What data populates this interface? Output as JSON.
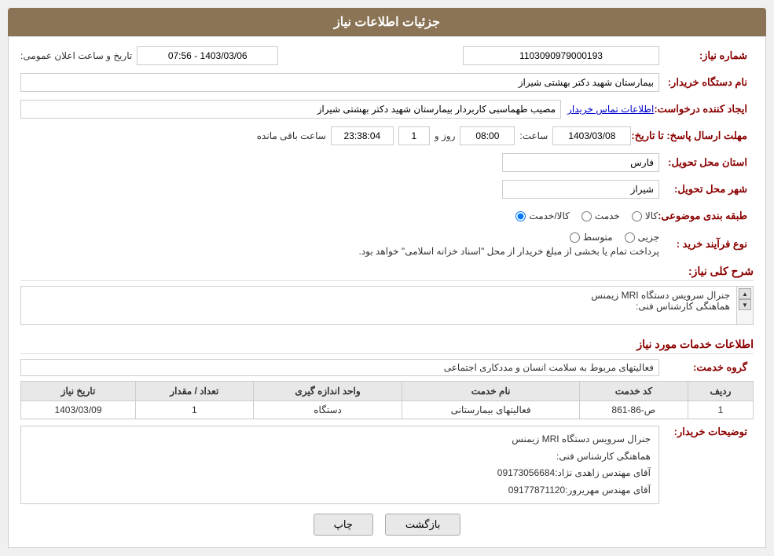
{
  "header": {
    "title": "جزئیات اطلاعات نیاز"
  },
  "fields": {
    "shomareNiaz_label": "شماره نیاز:",
    "shomareNiaz_value": "1103090979000193",
    "namDastgah_label": "نام دستگاه خریدار:",
    "namDastgah_value": "بیمارستان شهید دکتر بهشتی شیراز",
    "ijadKonande_label": "ایجاد کننده درخواست:",
    "ijadKonande_value": "مصیب طهماسبی کاربردار بیمارستان شهید دکتر بهشتی شیراز",
    "ijadKonande_link": "اطلاعات تماس خریدار",
    "mohlat_label": "مهلت ارسال پاسخ: تا تاریخ:",
    "mohlat_date": "1403/03/08",
    "mohlat_saat_label": "ساعت:",
    "mohlat_saat": "08:00",
    "mohlat_roz_label": "روز و",
    "mohlat_roz": "1",
    "mohlat_baqi_label": "ساعت باقی مانده",
    "mohlat_baqi": "23:38:04",
    "ostan_label": "استان محل تحویل:",
    "ostan_value": "فارس",
    "shahr_label": "شهر محل تحویل:",
    "shahr_value": "شیراز",
    "tabaqe_label": "طبقه بندی موضوعی:",
    "tabaqe_radio1": "کالا",
    "tabaqe_radio2": "خدمت",
    "tabaqe_radio3": "کالا/خدمت",
    "noeFarayand_label": "نوع فرآیند خرید :",
    "noeFarayand_radio1": "جزیی",
    "noeFarayand_radio2": "متوسط",
    "noeFarayand_notice": "پرداخت تمام یا بخشی از مبلغ خریدار از محل \"اسناد خزانه اسلامی\" خواهد بود.",
    "sharhKoli_label": "شرح کلی نیاز:",
    "sharhKoli_line1": "جنرال سرویس دستگاه MRI زیمنس",
    "sharhKoli_line2": "هماهنگی کارشناس فنی:",
    "taarikh_label": "تاریخ و ساعت اعلان عمومی:",
    "taarikh_value": "1403/03/06 - 07:56",
    "etelaat_section": "اطلاعات خدمات مورد نیاز",
    "grohe_label": "گروه خدمت:",
    "grohe_value": "فعالیتهای مربوط به سلامت انسان و مددکاری اجتماعی",
    "table_headers": {
      "radif": "ردیف",
      "kodKhadamat": "کد خدمت",
      "namKhadamat": "نام خدمت",
      "vahedAndaze": "واحد اندازه گیری",
      "tedadMeqdar": "تعداد / مقدار",
      "tarikheNiaz": "تاریخ نیاز"
    },
    "table_rows": [
      {
        "radif": "1",
        "kodKhadamat": "ص-86-861",
        "namKhadamat": "فعالیتهای بیمارستانی",
        "vahedAndaze": "دستگاه",
        "tedadMeqdar": "1",
        "tarikheNiaz": "1403/03/09"
      }
    ],
    "toseef_label": "توضیحات خریدار:",
    "toseef_line1": "جنرال سرویس دستگاه MRI زیمنس",
    "toseef_line2": "هماهنگی کارشناس فنی:",
    "toseef_line3": "آقای مهندس زاهدی نژاد:09173056684",
    "toseef_line4": "آقای مهندس مهریرور:09177871120"
  },
  "buttons": {
    "bazgasht": "بازگشت",
    "chap": "چاپ"
  }
}
